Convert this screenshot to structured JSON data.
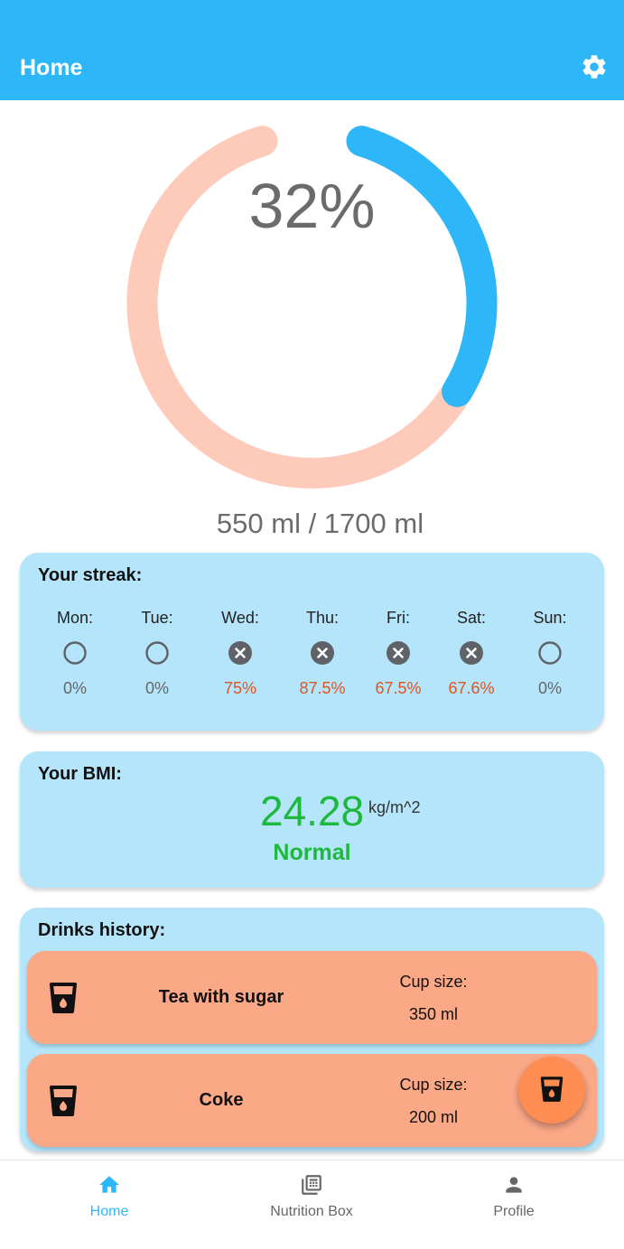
{
  "appbar": {
    "title": "Home",
    "settings_icon": "gear-icon"
  },
  "progress": {
    "percent_label": "32%",
    "fraction": 0.32,
    "amount_label": "550 ml / 1700 ml",
    "colors": {
      "filled": "#2db7f9",
      "track": "#fecbbb"
    }
  },
  "streak": {
    "title": "Your streak:",
    "days": [
      {
        "name": "Mon:",
        "status": "empty",
        "pct": "0%"
      },
      {
        "name": "Tue:",
        "status": "empty",
        "pct": "0%"
      },
      {
        "name": "Wed:",
        "status": "missed",
        "pct": "75%"
      },
      {
        "name": "Thu:",
        "status": "missed",
        "pct": "87.5%"
      },
      {
        "name": "Fri:",
        "status": "missed",
        "pct": "67.5%"
      },
      {
        "name": "Sat:",
        "status": "missed",
        "pct": "67.6%"
      },
      {
        "name": "Sun:",
        "status": "empty",
        "pct": "0%"
      }
    ],
    "colors": {
      "missed_pct": "#e0541f",
      "empty_pct": "#666666"
    }
  },
  "bmi": {
    "title": "Your BMI:",
    "value": "24.28",
    "unit": "kg/m^2",
    "category": "Normal",
    "color": "#1db83c"
  },
  "history": {
    "title": "Drinks history:",
    "items": [
      {
        "name": "Tea with sugar",
        "cup_label": "Cup size:",
        "cup_size": "350 ml",
        "icon": "cup-icon"
      },
      {
        "name": "Coke",
        "cup_label": "Cup size:",
        "cup_size": "200 ml",
        "icon": "cup-icon"
      }
    ]
  },
  "fab": {
    "icon": "cup-icon",
    "color": "#fd8d52"
  },
  "nav": {
    "items": [
      {
        "label": "Home",
        "icon": "home-icon",
        "active": true
      },
      {
        "label": "Nutrition Box",
        "icon": "nutrition-box-icon",
        "active": false
      },
      {
        "label": "Profile",
        "icon": "person-icon",
        "active": false
      }
    ],
    "colors": {
      "active": "#2db7f9",
      "inactive": "#666666"
    }
  }
}
